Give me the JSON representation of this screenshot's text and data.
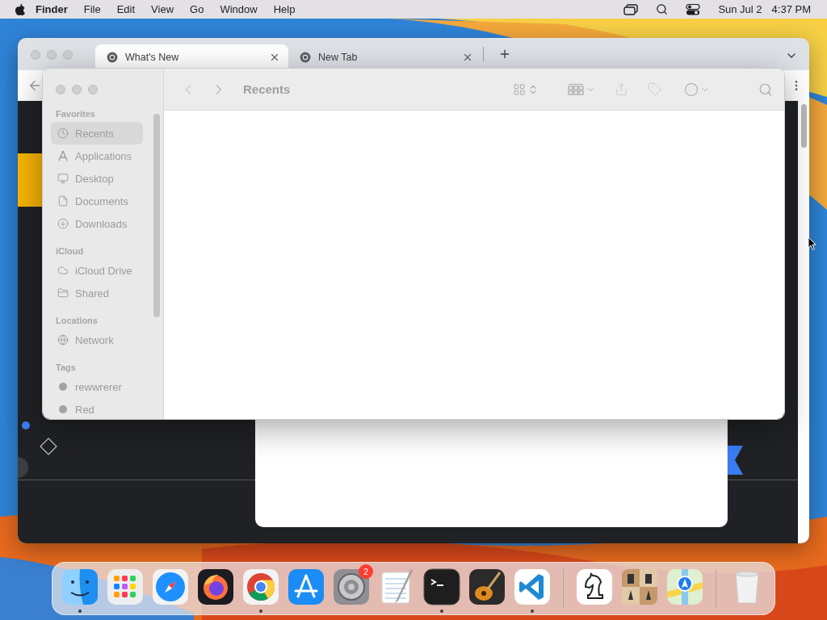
{
  "menu_bar": {
    "app": "Finder",
    "menus": [
      "File",
      "Edit",
      "View",
      "Go",
      "Window",
      "Help"
    ],
    "date": "Sun Jul 2",
    "time": "4:37 PM"
  },
  "browser": {
    "tabs": [
      {
        "title": "What's New",
        "selected": true
      },
      {
        "title": "New Tab",
        "selected": false
      }
    ]
  },
  "finder": {
    "title": "Recents",
    "sidebar": [
      {
        "heading": "Favorites",
        "items": [
          {
            "label": "Recents",
            "kind": "clock",
            "selected": true
          },
          {
            "label": "Applications",
            "kind": "apps",
            "selected": false
          },
          {
            "label": "Desktop",
            "kind": "desktop",
            "selected": false
          },
          {
            "label": "Documents",
            "kind": "document",
            "selected": false
          },
          {
            "label": "Downloads",
            "kind": "download",
            "selected": false
          }
        ]
      },
      {
        "heading": "iCloud",
        "items": [
          {
            "label": "iCloud Drive",
            "kind": "cloud",
            "selected": false
          },
          {
            "label": "Shared",
            "kind": "shared",
            "selected": false
          }
        ]
      },
      {
        "heading": "Locations",
        "items": [
          {
            "label": "Network",
            "kind": "network",
            "selected": false
          }
        ]
      },
      {
        "heading": "Tags",
        "items": [
          {
            "label": "rewwrerer",
            "kind": "tag",
            "selected": false
          },
          {
            "label": "Red",
            "kind": "tag",
            "selected": false
          }
        ]
      }
    ]
  },
  "dock": {
    "apps": [
      {
        "kind": "finder",
        "running": true
      },
      {
        "kind": "launchpad",
        "running": false
      },
      {
        "kind": "safari",
        "running": false
      },
      {
        "kind": "firefox",
        "running": false
      },
      {
        "kind": "chrome",
        "running": true
      },
      {
        "kind": "appstore",
        "running": false
      },
      {
        "kind": "settings",
        "running": false,
        "badge": "2"
      },
      {
        "kind": "textedit",
        "running": false
      },
      {
        "kind": "terminal",
        "running": true
      },
      {
        "kind": "garageband",
        "running": false
      },
      {
        "kind": "vscode",
        "running": true
      }
    ],
    "recent": [
      {
        "kind": "chess",
        "running": false
      },
      {
        "kind": "chessboard",
        "running": false
      },
      {
        "kind": "maps",
        "running": false
      }
    ],
    "trash": {
      "kind": "trash",
      "running": false
    }
  }
}
